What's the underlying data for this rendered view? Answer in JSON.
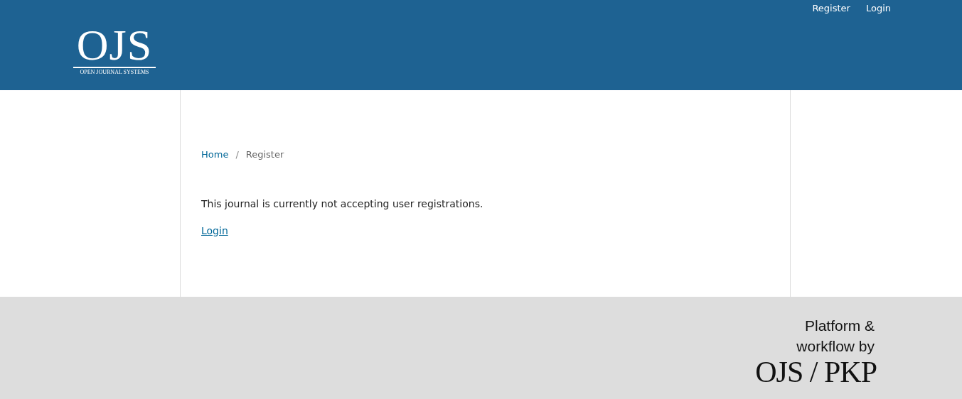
{
  "header": {
    "user_nav": [
      "Register",
      "Login"
    ],
    "logo": {
      "title": "OJS",
      "subtitle": "OPEN JOURNAL SYSTEMS"
    }
  },
  "breadcrumbs": [
    {
      "label": "Home",
      "kind": "link"
    },
    {
      "label": "Register",
      "kind": "current"
    }
  ],
  "breadcrumb_separator": "/",
  "message": "This journal is currently not accepting user registrations.",
  "login_link": "Login",
  "footer": {
    "credit_lines": [
      "Platform &",
      "workflow by"
    ],
    "logo": "OJS / PKP"
  }
}
